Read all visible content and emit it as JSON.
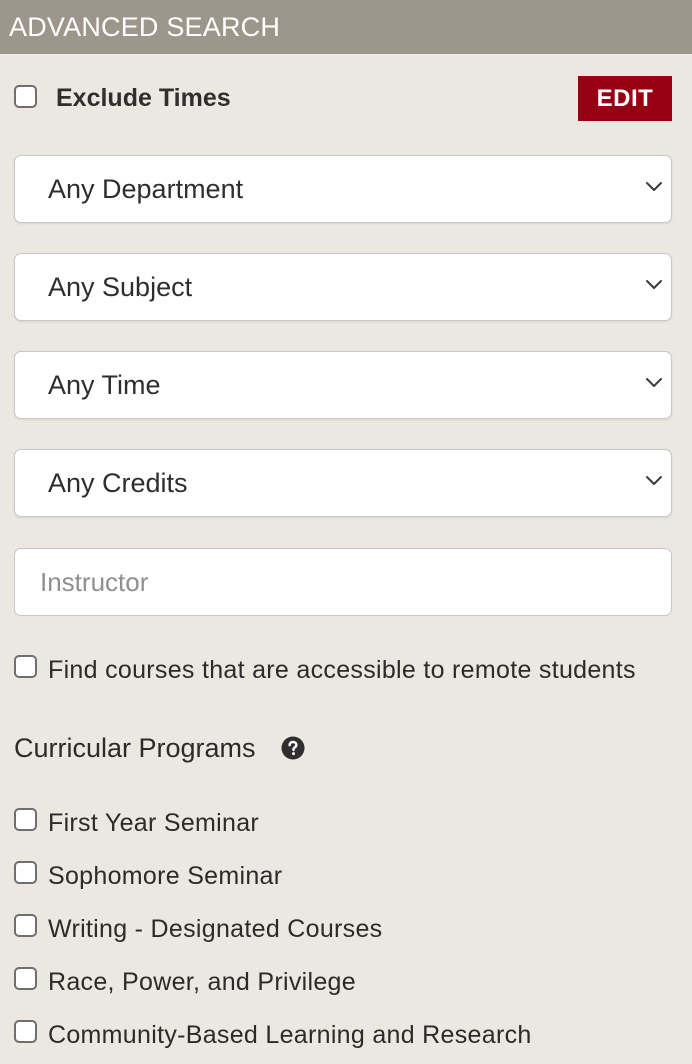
{
  "header": {
    "title": "ADVANCED SEARCH"
  },
  "exclude_times": {
    "label": "Exclude Times",
    "checked": false,
    "edit_label": "EDIT"
  },
  "filters": {
    "department": "Any Department",
    "subject": "Any Subject",
    "time": "Any Time",
    "credits": "Any Credits"
  },
  "instructor": {
    "placeholder": "Instructor",
    "value": ""
  },
  "remote": {
    "label": "Find courses that are accessible to remote students",
    "checked": false
  },
  "programs": {
    "heading": "Curricular Programs",
    "help_icon": "question-circle-icon",
    "items": [
      {
        "label": "First Year Seminar",
        "checked": false
      },
      {
        "label": "Sophomore Seminar",
        "checked": false
      },
      {
        "label": "Writing - Designated Courses",
        "checked": false
      },
      {
        "label": "Race, Power, and Privilege",
        "checked": false
      },
      {
        "label": "Community-Based Learning and Research",
        "checked": false
      }
    ]
  },
  "colors": {
    "header_bg": "#9d968a",
    "page_bg": "#ebe7e1",
    "accent": "#970012"
  }
}
